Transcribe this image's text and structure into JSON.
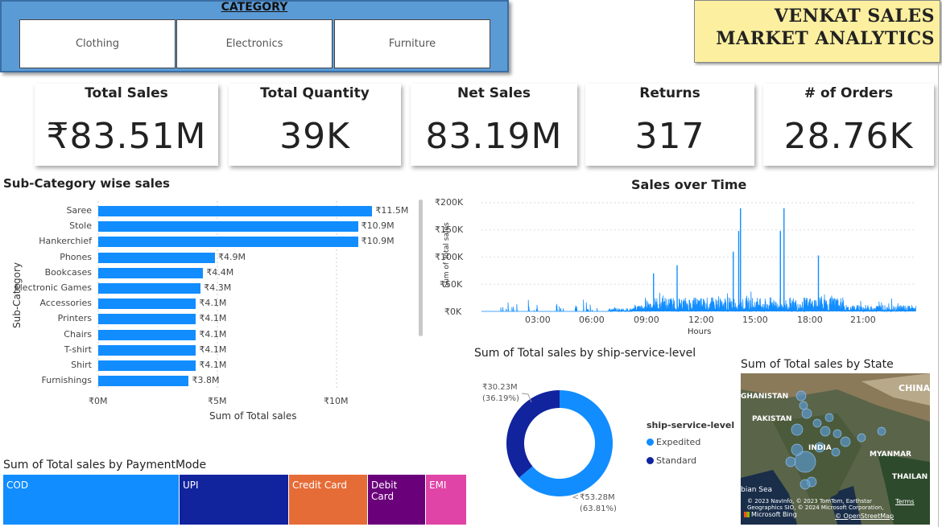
{
  "category": {
    "title": "CATEGORY",
    "options": [
      "Clothing",
      "Electronics",
      "Furniture"
    ]
  },
  "brand": {
    "line1": "VENKAT  SALES",
    "line2": "MARKET ANALYTICS"
  },
  "kpis": [
    {
      "label": "Total Sales",
      "value": "₹83.51M"
    },
    {
      "label": "Total Quantity",
      "value": "39K"
    },
    {
      "label": "Net Sales",
      "value": "83.19M"
    },
    {
      "label": "Returns",
      "value": "317"
    },
    {
      "label": "# of Orders",
      "value": "28.76K"
    }
  ],
  "colors": {
    "bar": "#118dff",
    "dark_blue": "#12239e",
    "slicer_bg": "#5b9bd5",
    "brand_bg": "#fcef9f"
  },
  "subcat": {
    "title": "Sub-Category wise sales",
    "y_label": "Sub-Category",
    "x_label": "Sum of Total sales",
    "x_ticks": [
      "₹0M",
      "₹5M",
      "₹10M"
    ]
  },
  "time_chart": {
    "title": "Sales over Time",
    "y_label": "Sum of Total sales",
    "x_label": "Hours",
    "y_ticks": [
      "₹200K",
      "₹150K",
      "₹100K",
      "₹50K",
      "₹0K"
    ],
    "x_ticks": [
      "03:00",
      "06:00",
      "09:00",
      "12:00",
      "15:00",
      "18:00",
      "21:00"
    ]
  },
  "ship": {
    "title": "Sum of Total sales by ship-service-level",
    "legend_title": "ship-service-level",
    "standard_label": "₹30.23M",
    "standard_pct": "(36.19%)",
    "expedited_label": "₹53.28M",
    "expedited_pct": "(63.81%)"
  },
  "payment": {
    "title": "Sum of Total sales by PaymentMode"
  },
  "state_map": {
    "title": "Sum of Total sales by State",
    "labels": {
      "afg": "GHANISTAN",
      "pak": "PAKISTAN",
      "india": "INDIA",
      "myanmar": "MYANMAR",
      "china": "CHINA",
      "thai": "THAILAN",
      "sea": "bian Sea"
    },
    "attribution": "© 2023 NavInfo, © 2023 TomTom, Earthstar Geographics SIO, © 2024 Microsoft Corporation,",
    "terms": "Terms",
    "osm": "© OpenStreetMap",
    "bing": "Microsoft Bing"
  },
  "chart_data": [
    {
      "type": "bar",
      "orientation": "horizontal",
      "title": "Sub-Category wise sales",
      "xlabel": "Sum of Total sales",
      "ylabel": "Sub-Category",
      "xlim": [
        0,
        12.5
      ],
      "categories": [
        "Saree",
        "Stole",
        "Hankerchief",
        "Phones",
        "Bookcases",
        "Electronic Games",
        "Accessories",
        "Printers",
        "Chairs",
        "T-shirt",
        "Shirt",
        "Furnishings"
      ],
      "values": [
        11.5,
        10.9,
        10.9,
        4.9,
        4.4,
        4.3,
        4.1,
        4.1,
        4.1,
        4.1,
        4.1,
        3.8
      ],
      "value_labels": [
        "₹11.5M",
        "₹10.9M",
        "₹10.9M",
        "₹4.9M",
        "₹4.4M",
        "₹4.3M",
        "₹4.1M",
        "₹4.1M",
        "₹4.1M",
        "₹4.1M",
        "₹4.1M",
        "₹3.8M"
      ]
    },
    {
      "type": "line",
      "title": "Sales over Time",
      "xlabel": "Hours",
      "ylabel": "Sum of Total sales",
      "ylim": [
        0,
        200000
      ],
      "x_range_hours": [
        0,
        24
      ],
      "peaks": [
        {
          "x": 14.3,
          "y": 190000
        },
        {
          "x": 16.7,
          "y": 190000
        },
        {
          "x": 14.2,
          "y": 148000
        },
        {
          "x": 16.5,
          "y": 148000
        },
        {
          "x": 13.9,
          "y": 110000
        },
        {
          "x": 10.8,
          "y": 85000
        },
        {
          "x": 18.6,
          "y": 103000
        },
        {
          "x": 9.5,
          "y": 70000
        }
      ]
    },
    {
      "type": "pie",
      "title": "Sum of Total sales by ship-service-level",
      "donut": true,
      "categories": [
        "Expedited",
        "Standard"
      ],
      "values": [
        53.28,
        30.23
      ],
      "colors": [
        "#118dff",
        "#12239e"
      ]
    },
    {
      "type": "heatmap",
      "subtype": "treemap",
      "title": "Sum of Total sales by PaymentMode",
      "categories": [
        "COD",
        "UPI",
        "Credit Card",
        "Debit Card",
        "EMI"
      ],
      "values": [
        36.2,
        26.8,
        19.3,
        14.1,
        9.9
      ],
      "colors": [
        "#118dff",
        "#12239e",
        "#e66c37",
        "#6b007b",
        "#e044a7"
      ]
    }
  ]
}
